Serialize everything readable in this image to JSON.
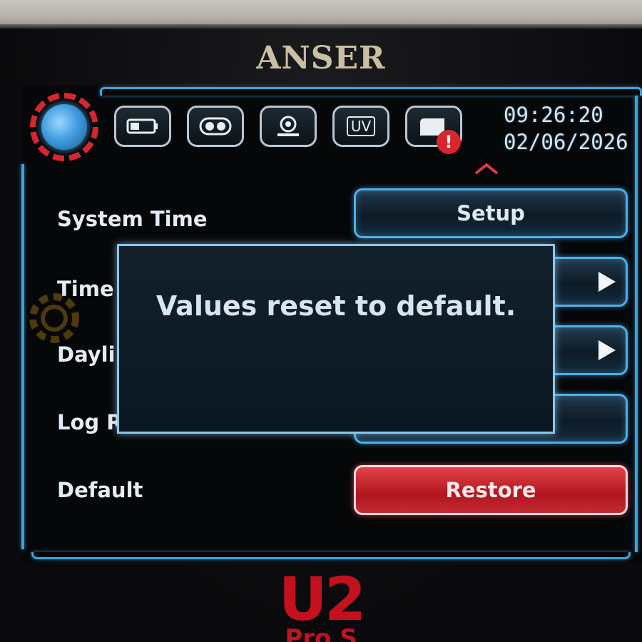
{
  "device": {
    "brand": "ANSER",
    "model_line1": "U2",
    "model_line2": "Pro S"
  },
  "header": {
    "time": "09:26:20",
    "date": "02/06/2026",
    "tabs": [
      {
        "name": "settings",
        "icon": "gear-icon",
        "active": true
      },
      {
        "name": "mode",
        "icon": "battery-icon"
      },
      {
        "name": "infrared",
        "icon": "infrared-icon"
      },
      {
        "name": "camera",
        "icon": "camera-icon"
      },
      {
        "name": "uv",
        "icon": "uv-icon",
        "label": "UV"
      },
      {
        "name": "log",
        "icon": "log-icon",
        "alert": "!"
      }
    ]
  },
  "settings": {
    "rows": [
      {
        "label": "System Time",
        "button": "Setup"
      },
      {
        "label": "Time",
        "button": ""
      },
      {
        "label": "Dayli",
        "button": ""
      },
      {
        "label": "Log R",
        "button": ""
      },
      {
        "label": "Default",
        "button": "Restore"
      }
    ]
  },
  "modal": {
    "message": "Values reset to default."
  },
  "colors": {
    "accent": "#4db0ec",
    "danger": "#d8252e",
    "text": "#e3ecf2"
  }
}
